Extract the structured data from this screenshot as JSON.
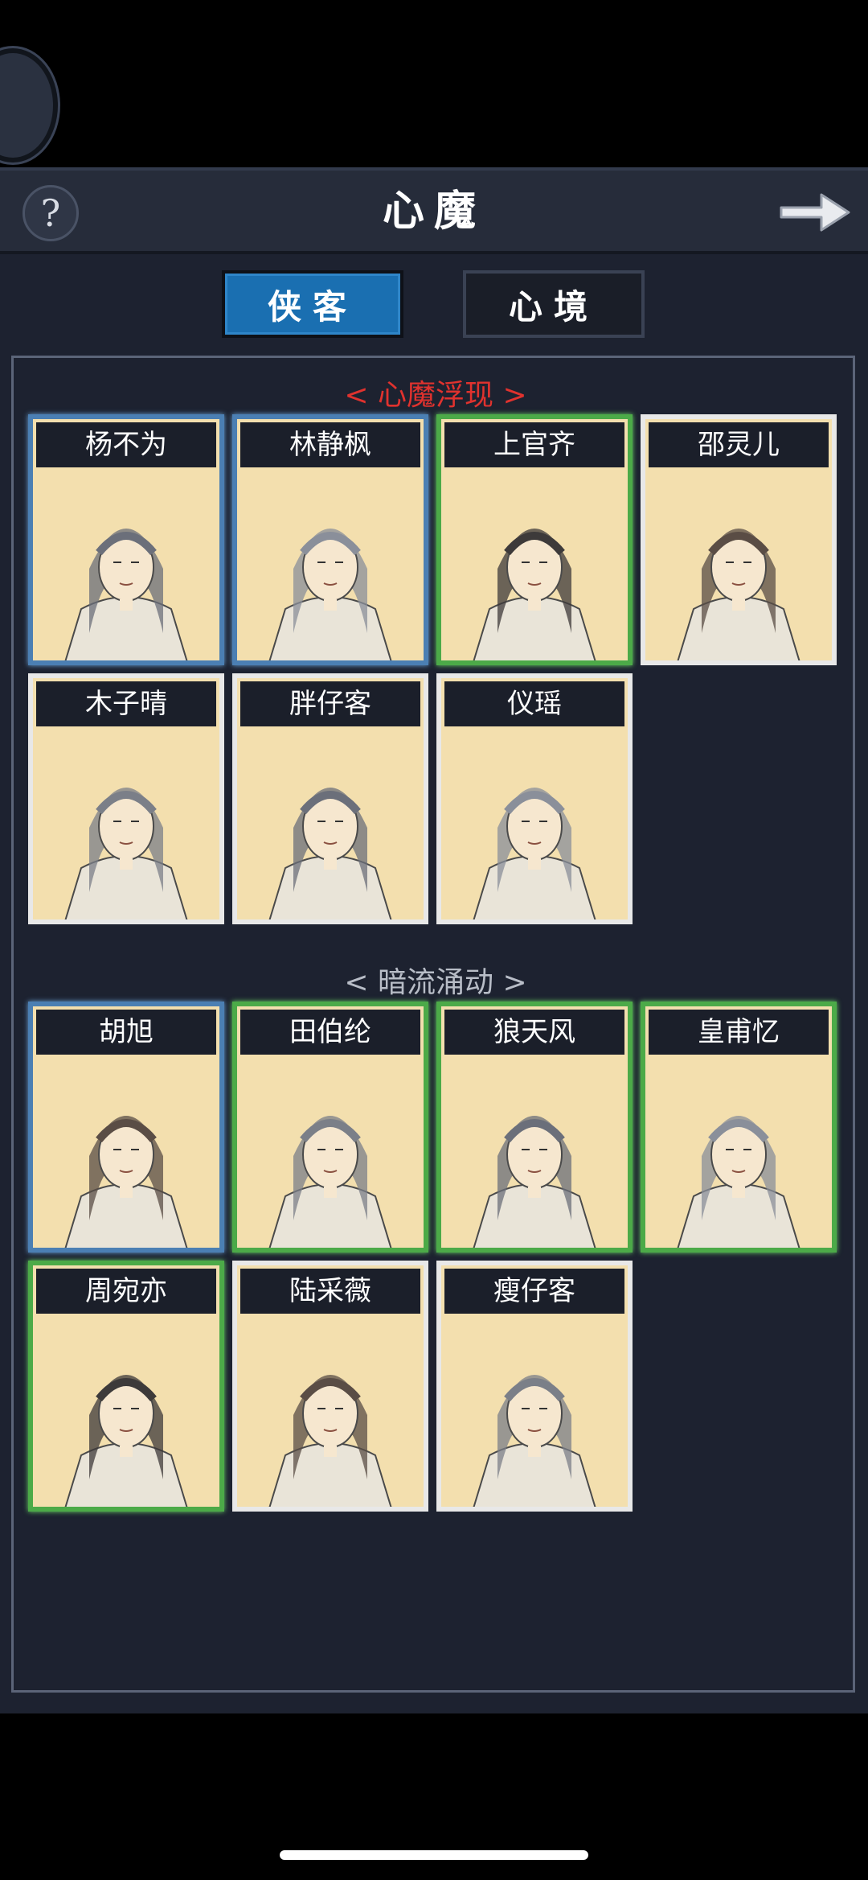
{
  "header": {
    "title": "心魔",
    "help_label": "?"
  },
  "tabs": [
    {
      "label": "侠客",
      "active": true
    },
    {
      "label": "心境",
      "active": false
    }
  ],
  "sections": [
    {
      "title": "< 心魔浮现 >",
      "color": "#e0322e",
      "cards": [
        {
          "name": "杨不为",
          "rarity": "blue"
        },
        {
          "name": "林静枫",
          "rarity": "blue"
        },
        {
          "name": "上官齐",
          "rarity": "green"
        },
        {
          "name": "邵灵儿",
          "rarity": "white"
        },
        {
          "name": "木子晴",
          "rarity": "white"
        },
        {
          "name": "胖仔客",
          "rarity": "white"
        },
        {
          "name": "仪瑶",
          "rarity": "white"
        }
      ]
    },
    {
      "title": "< 暗流涌动 >",
      "color": "#b8bdc7",
      "cards": [
        {
          "name": "胡旭",
          "rarity": "blue"
        },
        {
          "name": "田伯纶",
          "rarity": "green"
        },
        {
          "name": "狼天风",
          "rarity": "green"
        },
        {
          "name": "皇甫忆",
          "rarity": "green"
        },
        {
          "name": "周宛亦",
          "rarity": "green"
        },
        {
          "name": "陆采薇",
          "rarity": "white"
        },
        {
          "name": "瘦仔客",
          "rarity": "white"
        }
      ]
    }
  ],
  "colors": {
    "tab_active": "#1a6fb1",
    "border_blue": "#4b7fb3",
    "border_green": "#4caa48"
  },
  "icons": {
    "help": "question-icon",
    "next": "arrow-right-icon"
  }
}
